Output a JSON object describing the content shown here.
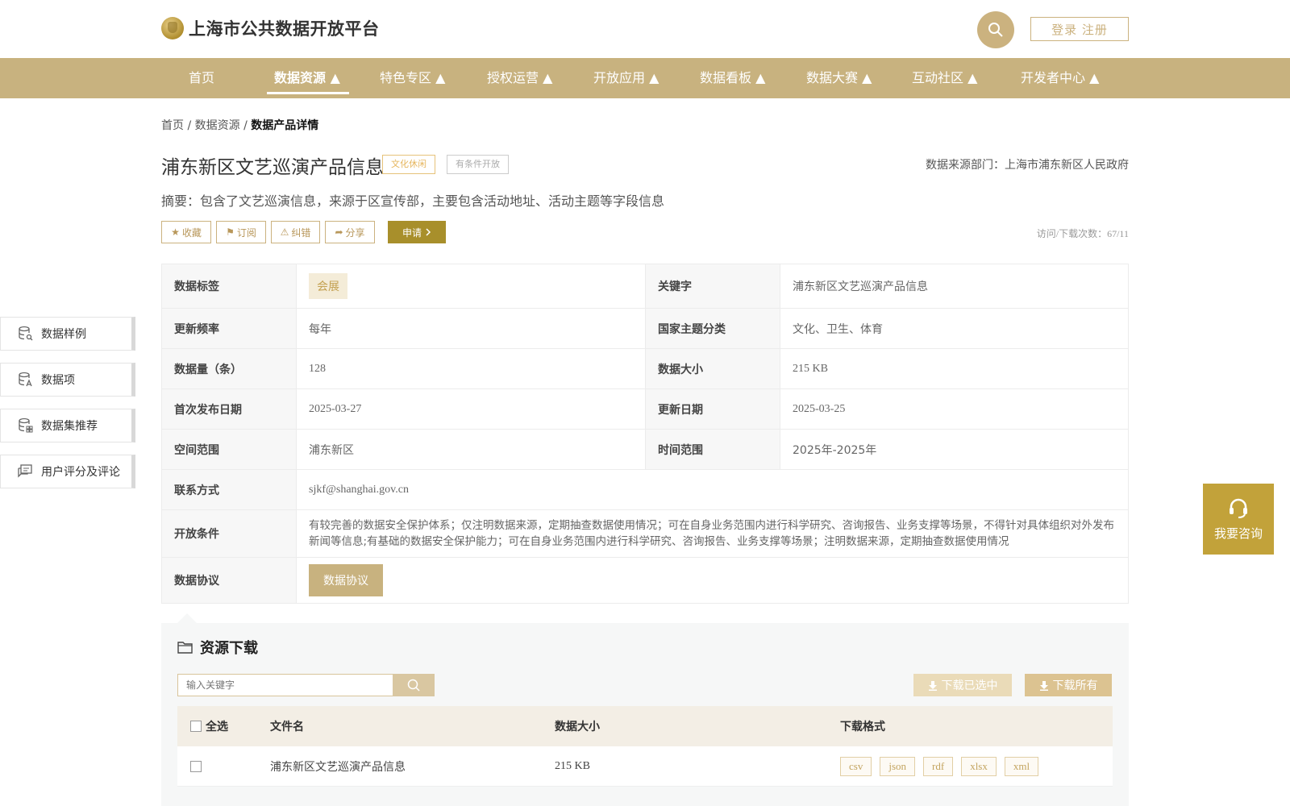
{
  "header": {
    "logo_text": "上海市公共数据开放平台",
    "login_label": "登录 注册"
  },
  "nav": [
    {
      "label": "首页"
    },
    {
      "label": "数据资源 ▲"
    },
    {
      "label": "特色专区 ▲"
    },
    {
      "label": "授权运营 ▲"
    },
    {
      "label": "开放应用 ▲"
    },
    {
      "label": "数据看板 ▲"
    },
    {
      "label": "数据大赛 ▲"
    },
    {
      "label": "互动社区 ▲"
    },
    {
      "label": "开发者中心 ▲"
    }
  ],
  "breadcrumb": {
    "home": "首页",
    "sep1": " / ",
    "resource": "数据资源",
    "sep2": " / ",
    "current": "数据产品详情"
  },
  "product": {
    "title": "浦东新区文艺巡演产品信息",
    "tag_category": "文化休闲",
    "tag_open": "有条件开放",
    "source": "数据来源部门：上海市浦东新区人民政府",
    "summary": "摘要：包含了文艺巡演信息，来源于区宣传部，主要包含活动地址、活动主题等字段信息",
    "visits": "访问/下载次数：67/11"
  },
  "actions": {
    "favorite": "收藏",
    "subscribe": "订阅",
    "report": "纠错",
    "share": "分享",
    "apply": "申请"
  },
  "info": {
    "tag_label": "数据标签",
    "tag_value": "会展",
    "keyword_label": "关键字",
    "keyword_value": "浦东新区文艺巡演产品信息",
    "freq_label": "更新频率",
    "freq_value": "每年",
    "theme_label": "国家主题分类",
    "theme_value": "文化、卫生、体育",
    "count_label": "数据量（条）",
    "count_value": "128",
    "size_label": "数据大小",
    "size_value": "215 KB",
    "first_label": "首次发布日期",
    "first_value": "2025-03-27",
    "update_label": "更新日期",
    "update_value": "2025-03-25",
    "space_label": "空间范围",
    "space_value": "浦东新区",
    "time_label": "时间范围",
    "time_value": "2025年-2025年",
    "contact_label": "联系方式",
    "contact_value": "sjkf@shanghai.gov.cn",
    "cond_label": "开放条件",
    "cond_value": "有较完善的数据安全保护体系；仅注明数据来源，定期抽查数据使用情况；可在自身业务范围内进行科学研究、咨询报告、业务支撑等场景，不得针对具体组织对外发布新闻等信息;有基础的数据安全保护能力；可在自身业务范围内进行科学研究、咨询报告、业务支撑等场景；注明数据来源，定期抽查数据使用情况",
    "protocol_label": "数据协议",
    "protocol_button": "数据协议"
  },
  "side": [
    {
      "label": "数据样例",
      "icon": "database-search-icon"
    },
    {
      "label": "数据项",
      "icon": "database-text-icon"
    },
    {
      "label": "数据集推荐",
      "icon": "database-grid-icon"
    },
    {
      "label": "用户评分及评论",
      "icon": "comment-icon"
    }
  ],
  "consult": {
    "label": "我要咨询"
  },
  "download": {
    "title": "资源下载",
    "search_placeholder": "输入关键字",
    "download_selected": "下载已选中",
    "download_all": "下载所有",
    "columns": {
      "select_all": "全选",
      "filename": "文件名",
      "size": "数据大小",
      "format": "下载格式"
    },
    "rows": [
      {
        "filename": "浦东新区文艺巡演产品信息",
        "size": "215 KB",
        "formats": [
          "csv",
          "json",
          "rdf",
          "xlsx",
          "xml"
        ]
      }
    ]
  },
  "colors": {
    "accent": "#c8b27f",
    "apply": "#a88f2b",
    "consult": "#c2a23a"
  }
}
